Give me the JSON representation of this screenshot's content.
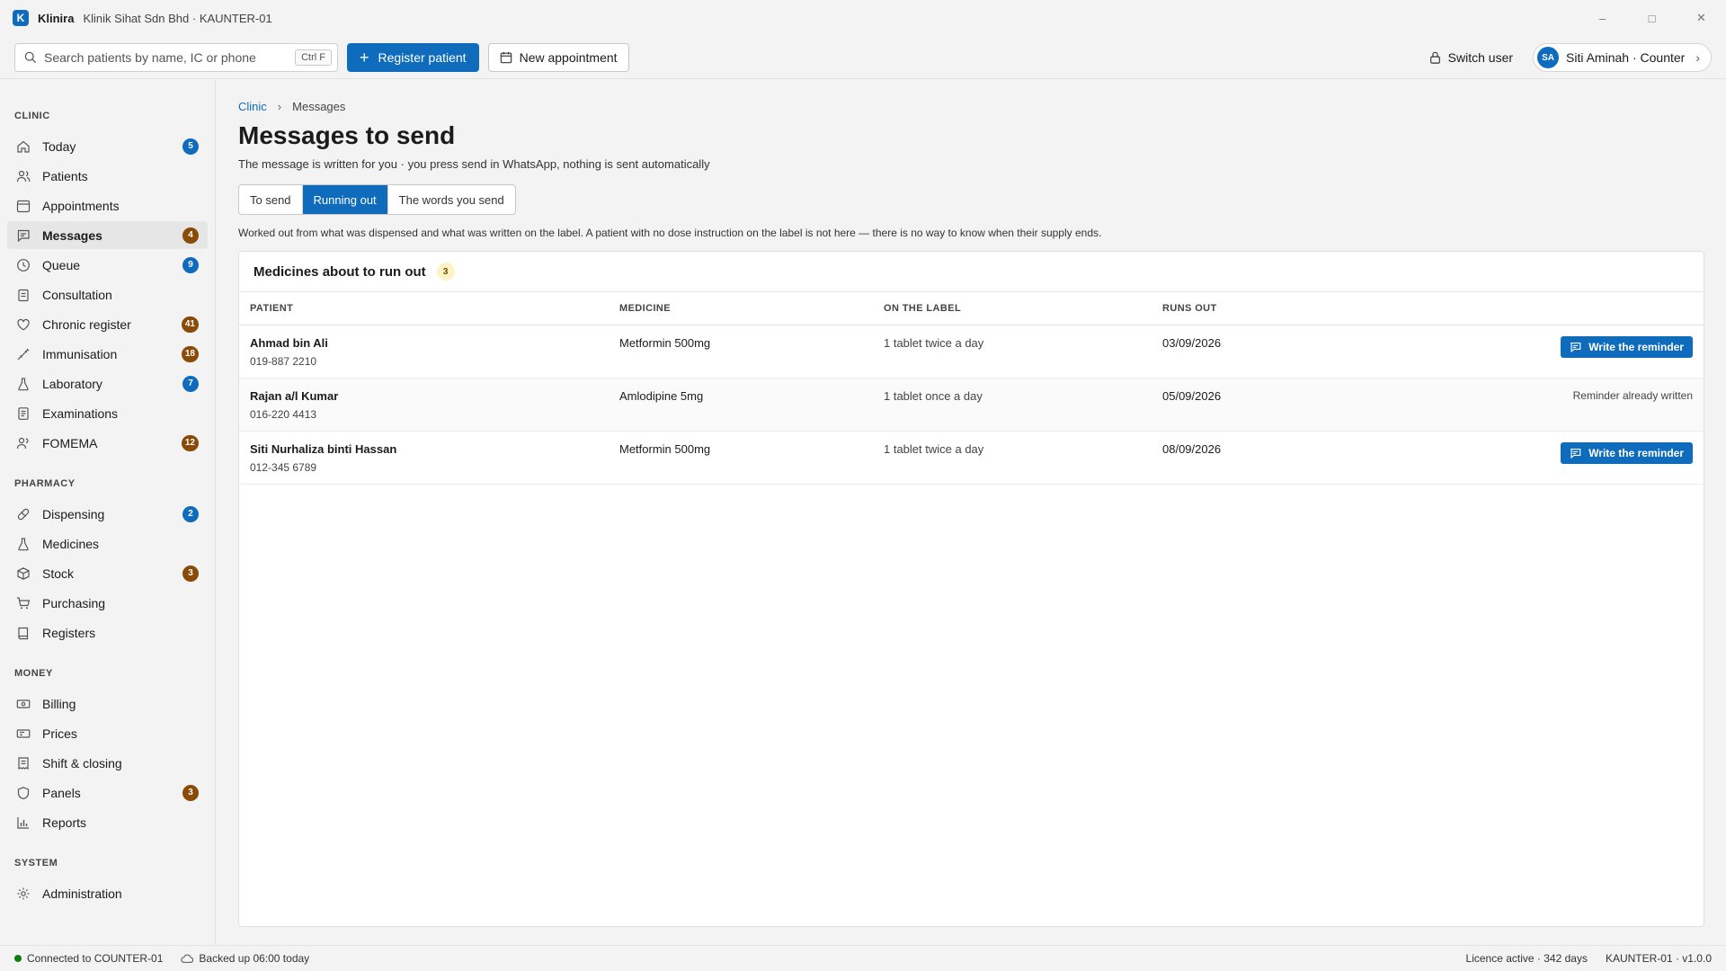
{
  "window": {
    "app_logo": "K",
    "app_name": "Klinira",
    "context": "Klinik Sihat Sdn Bhd · KAUNTER-01",
    "controls": {
      "minimize": "–",
      "maximize": "□",
      "close": "✕"
    }
  },
  "toolbar": {
    "search_placeholder": "Search patients by name, IC or phone",
    "search_shortcut": "Ctrl F",
    "register_label": "Register patient",
    "appointment_label": "New appointment",
    "switch_user_label": "Switch user",
    "user_initials": "SA",
    "user_label": "Siti Aminah · Counter"
  },
  "sidebar": {
    "sections": [
      {
        "title": "CLINIC",
        "items": [
          {
            "label": "Today",
            "icon": "home-icon",
            "badge": "5",
            "badge_color": "blue"
          },
          {
            "label": "Patients",
            "icon": "people-icon",
            "badge": ""
          },
          {
            "label": "Appointments",
            "icon": "calendar-icon",
            "badge": ""
          },
          {
            "label": "Messages",
            "icon": "chat-icon",
            "badge": "4",
            "badge_color": "amber",
            "active": true
          },
          {
            "label": "Queue",
            "icon": "clock-icon",
            "badge": "9",
            "badge_color": "blue"
          },
          {
            "label": "Consultation",
            "icon": "clipboard-icon",
            "badge": ""
          },
          {
            "label": "Chronic register",
            "icon": "heart-icon",
            "badge": "41",
            "badge_color": "amber"
          },
          {
            "label": "Immunisation",
            "icon": "syringe-icon",
            "badge": "18",
            "badge_color": "amber"
          },
          {
            "label": "Laboratory",
            "icon": "flask-icon",
            "badge": "7",
            "badge_color": "blue"
          },
          {
            "label": "Examinations",
            "icon": "document-icon",
            "badge": ""
          },
          {
            "label": "FOMEMA",
            "icon": "person-icon",
            "badge": "12",
            "badge_color": "amber"
          }
        ]
      },
      {
        "title": "PHARMACY",
        "items": [
          {
            "label": "Dispensing",
            "icon": "pill-icon",
            "badge": "2",
            "badge_color": "blue"
          },
          {
            "label": "Medicines",
            "icon": "flask-icon",
            "badge": ""
          },
          {
            "label": "Stock",
            "icon": "box-icon",
            "badge": "3",
            "badge_color": "amber"
          },
          {
            "label": "Purchasing",
            "icon": "cart-icon",
            "badge": ""
          },
          {
            "label": "Registers",
            "icon": "book-icon",
            "badge": ""
          }
        ]
      },
      {
        "title": "MONEY",
        "items": [
          {
            "label": "Billing",
            "icon": "money-icon",
            "badge": ""
          },
          {
            "label": "Prices",
            "icon": "tag-icon",
            "badge": ""
          },
          {
            "label": "Shift & closing",
            "icon": "receipt-icon",
            "badge": ""
          },
          {
            "label": "Panels",
            "icon": "shield-icon",
            "badge": "3",
            "badge_color": "amber"
          },
          {
            "label": "Reports",
            "icon": "chart-icon",
            "badge": ""
          }
        ]
      },
      {
        "title": "SYSTEM",
        "items": [
          {
            "label": "Administration",
            "icon": "gear-icon",
            "badge": ""
          }
        ]
      }
    ]
  },
  "main": {
    "breadcrumb": {
      "root": "Clinic",
      "current": "Messages"
    },
    "title": "Messages to send",
    "subtitle": "The message is written for you · you press send in WhatsApp, nothing is sent automatically",
    "tabs": [
      {
        "label": "To send",
        "active": false
      },
      {
        "label": "Running out",
        "active": true
      },
      {
        "label": "The words you send",
        "active": false
      }
    ],
    "note": "Worked out from what was dispensed and what was written on the label. A patient with no dose instruction on the label is not here — there is no way to know when their supply ends.",
    "card": {
      "title": "Medicines about to run out",
      "count": "3",
      "columns": [
        "PATIENT",
        "MEDICINE",
        "ON THE LABEL",
        "RUNS OUT"
      ],
      "rows": [
        {
          "name": "Ahmad bin Ali",
          "phone": "019-887 2210",
          "medicine": "Metformin 500mg",
          "label": "1 tablet twice a day",
          "runs_out": "03/09/2026",
          "action": "Write the reminder",
          "done": false
        },
        {
          "name": "Rajan a/l Kumar",
          "phone": "016-220 4413",
          "medicine": "Amlodipine 5mg",
          "label": "1 tablet once a day",
          "runs_out": "05/09/2026",
          "action": "Reminder already written",
          "done": true
        },
        {
          "name": "Siti Nurhaliza binti Hassan",
          "phone": "012-345 6789",
          "medicine": "Metformin 500mg",
          "label": "1 tablet twice a day",
          "runs_out": "08/09/2026",
          "action": "Write the reminder",
          "done": false
        }
      ]
    }
  },
  "status": {
    "connection": "Connected to COUNTER-01",
    "backup": "Backed up 06:00 today",
    "licence": "Licence active · 342 days",
    "version": "KAUNTER-01 · v1.0.0"
  },
  "colors": {
    "accent": "#0f6cbd",
    "badge_amber": "#8a4b08",
    "status_ok": "#107c10"
  }
}
